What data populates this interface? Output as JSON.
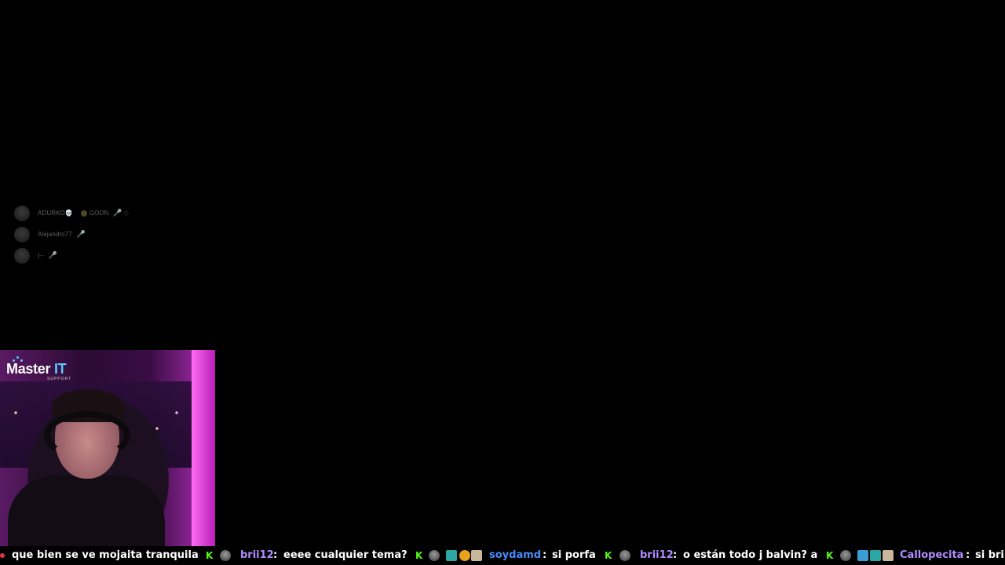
{
  "voice_overlay": {
    "members": [
      {
        "name": "ADURKO💀",
        "tag": "GOON",
        "status": "🎤 ⦸"
      },
      {
        "name": "Alejandro77",
        "tag": "",
        "status": "🎤"
      },
      {
        "name": "|--",
        "tag": "",
        "status": "🎤"
      }
    ]
  },
  "webcam": {
    "logo_text": "Master",
    "logo_accent": "IT",
    "logo_sub": "SUPPORT"
  },
  "chat_ticker": {
    "colors": {
      "user_purple": "#b18cff",
      "user_blue": "#4a8cff",
      "message": "#ffffff",
      "kick_green": "#53fc18"
    },
    "lead_message": "que bien se ve mojaita  tranquila",
    "messages": [
      {
        "user": "brii12",
        "sep": ":",
        "text": "eeee cualquier tema?"
      },
      {
        "user": "soydamd",
        "sep": ":",
        "text": "si porfa"
      },
      {
        "user": "brii12",
        "sep": ":",
        "text": "o están todo j balvin?  a"
      },
      {
        "user": "Callopecita",
        "sep": ":",
        "text": "si bri"
      }
    ],
    "icons": [
      "kick-icon",
      "avatar-icon",
      "badge-icon"
    ]
  }
}
